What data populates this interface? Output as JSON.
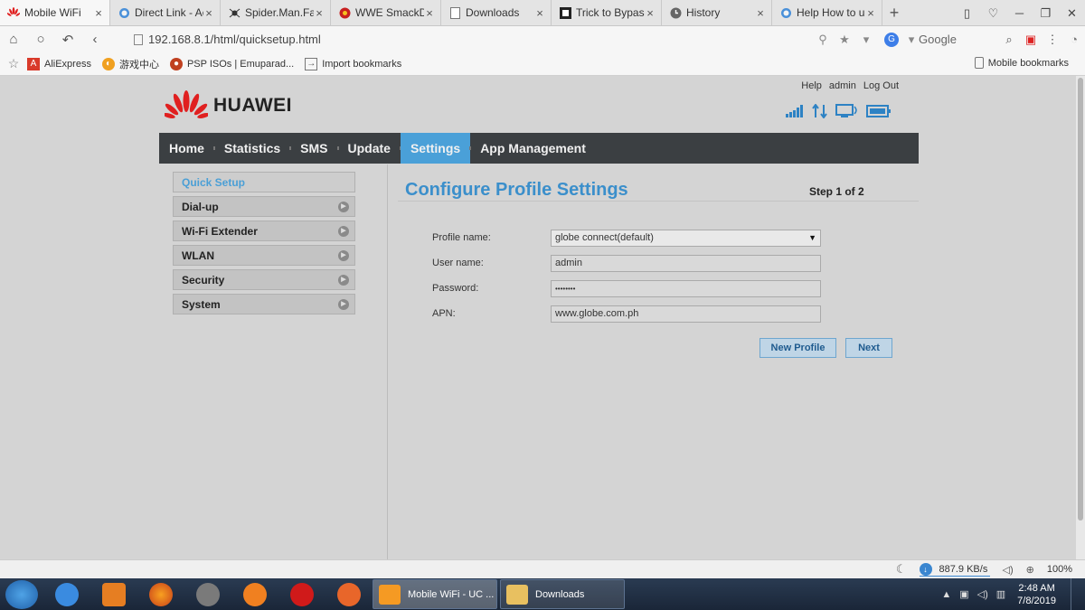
{
  "browser": {
    "tabs": [
      {
        "label": "Mobile WiFi",
        "icon": "huawei-icon",
        "active": true
      },
      {
        "label": "Direct Link - Ac",
        "icon": "globe-icon"
      },
      {
        "label": "Spider.Man.Far",
        "icon": "spider-icon"
      },
      {
        "label": "WWE SmackDo",
        "icon": "wwe-icon"
      },
      {
        "label": "Downloads",
        "icon": "page-icon"
      },
      {
        "label": "Trick to Bypass",
        "icon": "bypass-icon"
      },
      {
        "label": "History",
        "icon": "clock-icon"
      },
      {
        "label": "Help How to u",
        "icon": "globe-icon"
      }
    ],
    "url": "192.168.8.1/html/quicksetup.html",
    "search_engine": "Google",
    "bookmarks": [
      {
        "label": "AliExpress",
        "color": "#d93a2a"
      },
      {
        "label": "游戏中心",
        "color": "#f0a020"
      },
      {
        "label": "PSP ISOs | Emuparad...",
        "color": "#c04020"
      },
      {
        "label": "Import bookmarks",
        "color": "#555555"
      }
    ],
    "mobile_bookmarks": "Mobile bookmarks"
  },
  "router": {
    "brand": "HUAWEI",
    "top_links": [
      "Help",
      "admin",
      "Log Out"
    ],
    "nav": [
      "Home",
      "Statistics",
      "SMS",
      "Update",
      "Settings",
      "App Management"
    ],
    "nav_active": "Settings",
    "side_menu": [
      "Quick Setup",
      "Dial-up",
      "Wi-Fi Extender",
      "WLAN",
      "Security",
      "System"
    ],
    "side_active": "Quick Setup",
    "title": "Configure Profile Settings",
    "step": "Step 1 of 2",
    "form": {
      "profile_label": "Profile name:",
      "profile_value": "globe connect(default)",
      "user_label": "User name:",
      "user_value": "admin",
      "password_label": "Password:",
      "password_value": "••••••••",
      "apn_label": "APN:",
      "apn_value": "www.globe.com.ph"
    },
    "buttons": {
      "new_profile": "New Profile",
      "next": "Next"
    }
  },
  "statusbar": {
    "speed": "887.9 KB/s",
    "zoom": "100%"
  },
  "taskbar": {
    "windows": [
      {
        "label": "Mobile WiFi - UC ...",
        "active": true
      },
      {
        "label": "Downloads",
        "active": false
      }
    ],
    "time": "2:48 AM",
    "date": "7/8/2019"
  },
  "colors": {
    "accent": "#4aa0d8",
    "title": "#3b8fcb",
    "nav_bg": "#3b3f42"
  }
}
